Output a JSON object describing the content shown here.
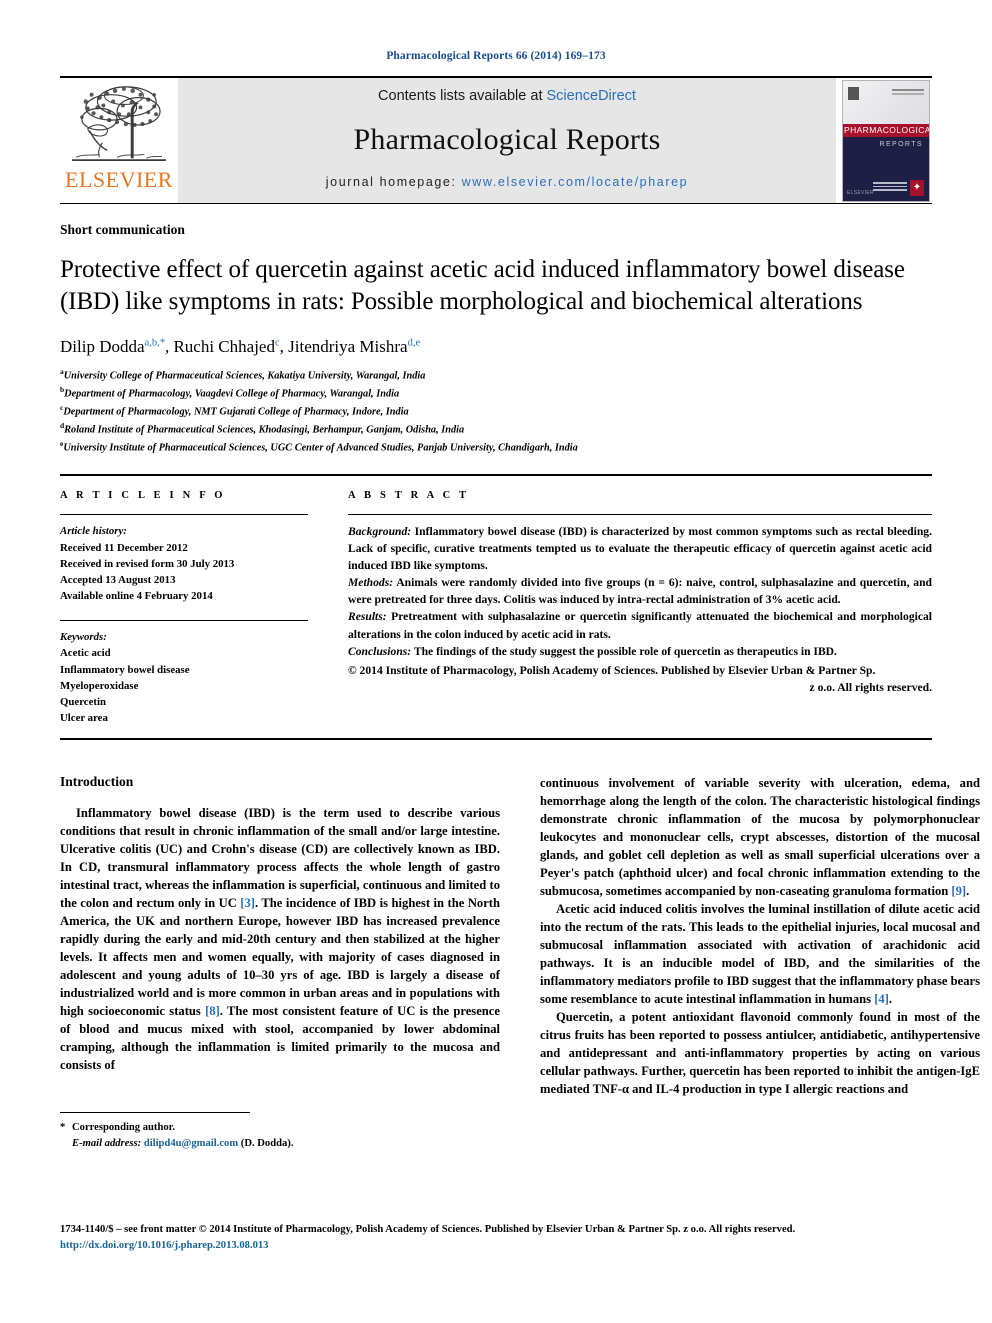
{
  "running_head": "Pharmacological Reports 66 (2014) 169–173",
  "masthead": {
    "publisher_name": "ELSEVIER",
    "contents_prefix": "Contents lists available at ",
    "contents_link": "ScienceDirect",
    "journal_name": "Pharmacological Reports",
    "homepage_label": "journal homepage:",
    "homepage_url": "www.elsevier.com/locate/pharep",
    "cover": {
      "band_text": "PHARMACOLOGICAL",
      "sub_text": "REPORTS",
      "publisher_foot": "ELSEVIER",
      "mark": "✦"
    },
    "link_color": "#2a6ebb"
  },
  "article": {
    "type": "Short communication",
    "title": "Protective effect of quercetin against acetic acid induced inflammatory bowel disease (IBD) like symptoms in rats: Possible morphological and biochemical alterations",
    "authors": [
      {
        "name": "Dilip Dodda",
        "marks": "a,b,*"
      },
      {
        "name": "Ruchi Chhajed",
        "marks": "c"
      },
      {
        "name": "Jitendriya Mishra",
        "marks": "d,e"
      }
    ],
    "affiliations": [
      {
        "mark": "a",
        "text": "University College of Pharmaceutical Sciences, Kakatiya University, Warangal, India"
      },
      {
        "mark": "b",
        "text": "Department of Pharmacology, Vaagdevi College of Pharmacy, Warangal, India"
      },
      {
        "mark": "c",
        "text": "Department of Pharmacology, NMT Gujarati College of Pharmacy, Indore, India"
      },
      {
        "mark": "d",
        "text": "Roland Institute of Pharmaceutical Sciences, Khodasingi, Berhampur, Ganjam, Odisha, India"
      },
      {
        "mark": "e",
        "text": "University Institute of Pharmaceutical Sciences, UGC Center of Advanced Studies, Panjab University, Chandigarh, India"
      }
    ]
  },
  "article_info": {
    "heading": "A R T I C L E   I N F O",
    "history_label": "Article history:",
    "history": [
      "Received 11 December 2012",
      "Received in revised form 30 July 2013",
      "Accepted 13 August 2013",
      "Available online 4 February 2014"
    ],
    "keywords_label": "Keywords:",
    "keywords": [
      "Acetic acid",
      "Inflammatory bowel disease",
      "Myeloperoxidase",
      "Quercetin",
      "Ulcer area"
    ]
  },
  "abstract": {
    "heading": "A B S T R A C T",
    "sections": [
      {
        "label": "Background:",
        "text": " Inflammatory bowel disease (IBD) is characterized by most common symptoms such as rectal bleeding. Lack of specific, curative treatments tempted us to evaluate the therapeutic efficacy of quercetin against acetic acid induced IBD like symptoms."
      },
      {
        "label": "Methods:",
        "text": " Animals were randomly divided into five groups (n = 6): naive, control, sulphasalazine and quercetin, and were pretreated for three days. Colitis was induced by intra-rectal administration of 3% acetic acid."
      },
      {
        "label": "Results:",
        "text": " Pretreatment with sulphasalazine or quercetin significantly attenuated the biochemical and morphological alterations in the colon induced by acetic acid in rats."
      },
      {
        "label": "Conclusions:",
        "text": " The findings of the study suggest the possible role of quercetin as therapeutics in IBD."
      }
    ],
    "copyright_line1": "© 2014 Institute of Pharmacology, Polish Academy of Sciences. Published by Elsevier Urban & Partner Sp.",
    "copyright_line2": "z o.o. All rights reserved."
  },
  "body": {
    "intro_heading": "Introduction",
    "left_paragraphs": [
      "Inflammatory bowel disease (IBD) is the term used to describe various conditions that result in chronic inflammation of the small and/or large intestine. Ulcerative colitis (UC) and Crohn's disease (CD) are collectively known as IBD. In CD, transmural inflammatory process affects the whole length of gastro intestinal tract, whereas the inflammation is superficial, continuous and limited to the colon and rectum only in UC [3]. The incidence of IBD is highest in the North America, the UK and northern Europe, however IBD has increased prevalence rapidly during the early and mid-20th century and then stabilized at the higher levels. It affects men and women equally, with majority of cases diagnosed in adolescent and young adults of 10–30 yrs of age. IBD is largely a disease of industrialized world and is more common in urban areas and in populations with high socioeconomic status [8]. The most consistent feature of UC is the presence of blood and mucus mixed with stool, accompanied by lower abdominal cramping, although the inflammation is limited primarily to the mucosa and consists of"
    ],
    "right_paragraphs": [
      "continuous involvement of variable severity with ulceration, edema, and hemorrhage along the length of the colon. The characteristic histological findings demonstrate chronic inflammation of the mucosa by polymorphonuclear leukocytes and mononuclear cells, crypt abscesses, distortion of the mucosal glands, and goblet cell depletion as well as small superficial ulcerations over a Peyer's patch (aphthoid ulcer) and focal chronic inflammation extending to the submucosa, sometimes accompanied by non-caseating granuloma formation [9].",
      "Acetic acid induced colitis involves the luminal instillation of dilute acetic acid into the rectum of the rats. This leads to the epithelial injuries, local mucosal and submucosal inflammation associated with activation of arachidonic acid pathways. It is an inducible model of IBD, and the similarities of the inflammatory mediators profile to IBD suggest that the inflammatory phase bears some resemblance to acute intestinal inflammation in humans [4].",
      "Quercetin, a potent antioxidant flavonoid commonly found in most of the citrus fruits has been reported to possess antiulcer, antidiabetic, antihypertensive and antidepressant and anti-inflammatory properties by acting on various cellular pathways. Further, quercetin has been reported to inhibit the antigen-IgE mediated TNF-α and IL-4 production in type I allergic reactions and"
    ]
  },
  "footnote": {
    "marker": "*",
    "corresponding": "Corresponding author.",
    "email_label": "E-mail address:",
    "email": "dilipd4u@gmail.com",
    "email_suffix": " (D. Dodda)."
  },
  "page_footer": {
    "issn_line": "1734-1140/$ – see front matter © 2014 Institute of Pharmacology, Polish Academy of Sciences. Published by Elsevier Urban & Partner Sp. z o.o. All rights reserved.",
    "doi": "http://dx.doi.org/10.1016/j.pharep.2013.08.013"
  }
}
